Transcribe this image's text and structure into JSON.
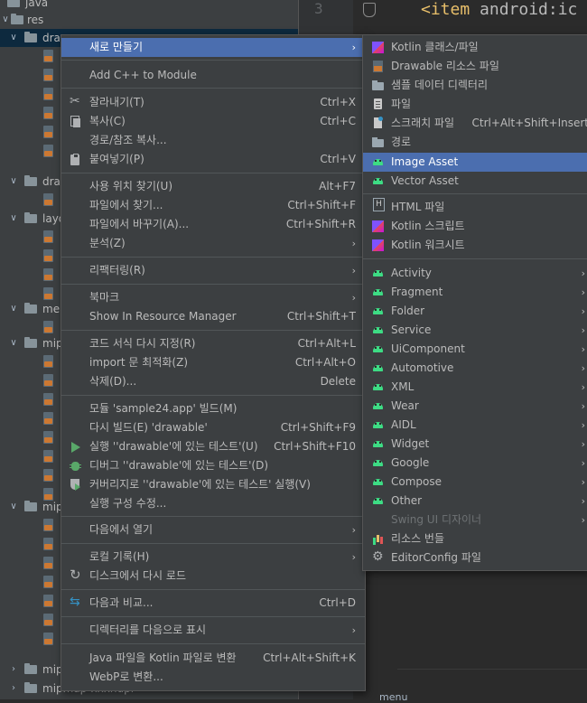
{
  "tree": {
    "rows": [
      {
        "label": "java"
      },
      {
        "label": "res"
      },
      {
        "label": "dra"
      },
      {
        "label": "dra"
      },
      {
        "label": "layo"
      },
      {
        "label": "me"
      },
      {
        "label": "mip"
      },
      {
        "label": "mip"
      },
      {
        "label": "mip"
      },
      {
        "label": "mipmap-xxxhdpi"
      }
    ]
  },
  "editor": {
    "line_number": "3",
    "code_tag": "<item",
    "code_attr": " android:ic",
    "bottom_text": "menu"
  },
  "context_menu": {
    "items": [
      {
        "label": "새로 만들기",
        "shortcut": "",
        "submenu": true,
        "selected": true
      },
      {
        "label": "Add C++ to Module",
        "shortcut": ""
      },
      {
        "label": "잘라내기(T)",
        "shortcut": "Ctrl+X",
        "icon": "cut-icon"
      },
      {
        "label": "복사(C)",
        "shortcut": "Ctrl+C",
        "icon": "copy-icon"
      },
      {
        "label": "경로/참조 복사...",
        "shortcut": ""
      },
      {
        "label": "붙여넣기(P)",
        "shortcut": "Ctrl+V",
        "icon": "paste-icon"
      },
      {
        "label": "사용 위치 찾기(U)",
        "shortcut": "Alt+F7"
      },
      {
        "label": "파일에서 찾기...",
        "shortcut": "Ctrl+Shift+F"
      },
      {
        "label": "파일에서 바꾸기(A)...",
        "shortcut": "Ctrl+Shift+R"
      },
      {
        "label": "분석(Z)",
        "shortcut": "",
        "submenu": true
      },
      {
        "label": "리팩터링(R)",
        "shortcut": "",
        "submenu": true
      },
      {
        "label": "북마크",
        "shortcut": "",
        "submenu": true
      },
      {
        "label": "Show In Resource Manager",
        "shortcut": "Ctrl+Shift+T"
      },
      {
        "label": "코드 서식 다시 지정(R)",
        "shortcut": "Ctrl+Alt+L"
      },
      {
        "label": "import 문 최적화(Z)",
        "shortcut": "Ctrl+Alt+O"
      },
      {
        "label": "삭제(D)...",
        "shortcut": "Delete"
      },
      {
        "label": "모듈 'sample24.app' 빌드(M)",
        "shortcut": ""
      },
      {
        "label": "다시 빌드(E) 'drawable'",
        "shortcut": "Ctrl+Shift+F9"
      },
      {
        "label": "실행 ''drawable'에 있는 테스트'(U)",
        "shortcut": "Ctrl+Shift+F10",
        "icon": "run-icon"
      },
      {
        "label": "디버그 ''drawable'에 있는 테스트'(D)",
        "shortcut": "",
        "icon": "debug-icon"
      },
      {
        "label": "커버리지로 ''drawable'에 있는 테스트' 실행(V)",
        "shortcut": "",
        "icon": "coverage-icon"
      },
      {
        "label": "실행 구성 수정...",
        "shortcut": ""
      },
      {
        "label": "다음에서 열기",
        "shortcut": "",
        "submenu": true
      },
      {
        "label": "로컬 기록(H)",
        "shortcut": "",
        "submenu": true
      },
      {
        "label": "디스크에서 다시 로드",
        "shortcut": "",
        "icon": "reload-icon"
      },
      {
        "label": "다음과 비교...",
        "shortcut": "Ctrl+D",
        "icon": "compare-icon"
      },
      {
        "label": "디렉터리를 다음으로 표시",
        "shortcut": "",
        "submenu": true
      },
      {
        "label": "Java 파일을 Kotlin 파일로 변환",
        "shortcut": "Ctrl+Alt+Shift+K"
      },
      {
        "label": "WebP로 변환...",
        "shortcut": ""
      }
    ]
  },
  "new_submenu": {
    "items": [
      {
        "label": "Kotlin 클래스/파일",
        "icon": "kotlin-icon"
      },
      {
        "label": "Drawable 리소스 파일",
        "icon": "xml-file-icon"
      },
      {
        "label": "샘플 데이터 디렉터리",
        "icon": "folder-icon"
      },
      {
        "label": "파일",
        "icon": "file-icon"
      },
      {
        "label": "스크래치 파일",
        "shortcut": "Ctrl+Alt+Shift+Insert",
        "icon": "scratch-file-icon"
      },
      {
        "label": "경로",
        "icon": "folder-icon"
      },
      {
        "label": "Image Asset",
        "icon": "android-icon",
        "selected": true
      },
      {
        "label": "Vector Asset",
        "icon": "android-icon"
      },
      {
        "label": "HTML 파일",
        "icon": "html-icon"
      },
      {
        "label": "Kotlin 스크립트",
        "icon": "kotlin-icon"
      },
      {
        "label": "Kotlin 워크시트",
        "icon": "kotlin-icon"
      },
      {
        "label": "Activity",
        "icon": "android-icon",
        "submenu": true
      },
      {
        "label": "Fragment",
        "icon": "android-icon",
        "submenu": true
      },
      {
        "label": "Folder",
        "icon": "android-icon",
        "submenu": true
      },
      {
        "label": "Service",
        "icon": "android-icon",
        "submenu": true
      },
      {
        "label": "UiComponent",
        "icon": "android-icon",
        "submenu": true
      },
      {
        "label": "Automotive",
        "icon": "android-icon",
        "submenu": true
      },
      {
        "label": "XML",
        "icon": "android-icon",
        "submenu": true
      },
      {
        "label": "Wear",
        "icon": "android-icon",
        "submenu": true
      },
      {
        "label": "AIDL",
        "icon": "android-icon",
        "submenu": true
      },
      {
        "label": "Widget",
        "icon": "android-icon",
        "submenu": true
      },
      {
        "label": "Google",
        "icon": "android-icon",
        "submenu": true
      },
      {
        "label": "Compose",
        "icon": "android-icon",
        "submenu": true
      },
      {
        "label": "Other",
        "icon": "android-icon",
        "submenu": true
      },
      {
        "label": "Swing UI 디자이너",
        "submenu": true,
        "disabled": true
      },
      {
        "label": "리소스 번들",
        "icon": "resource-bundle-icon"
      },
      {
        "label": "EditorConfig 파일",
        "icon": "gear-icon"
      }
    ]
  },
  "glyphs": {
    "arrow": "›",
    "chev_open": "∨",
    "chev_closed": "›"
  }
}
